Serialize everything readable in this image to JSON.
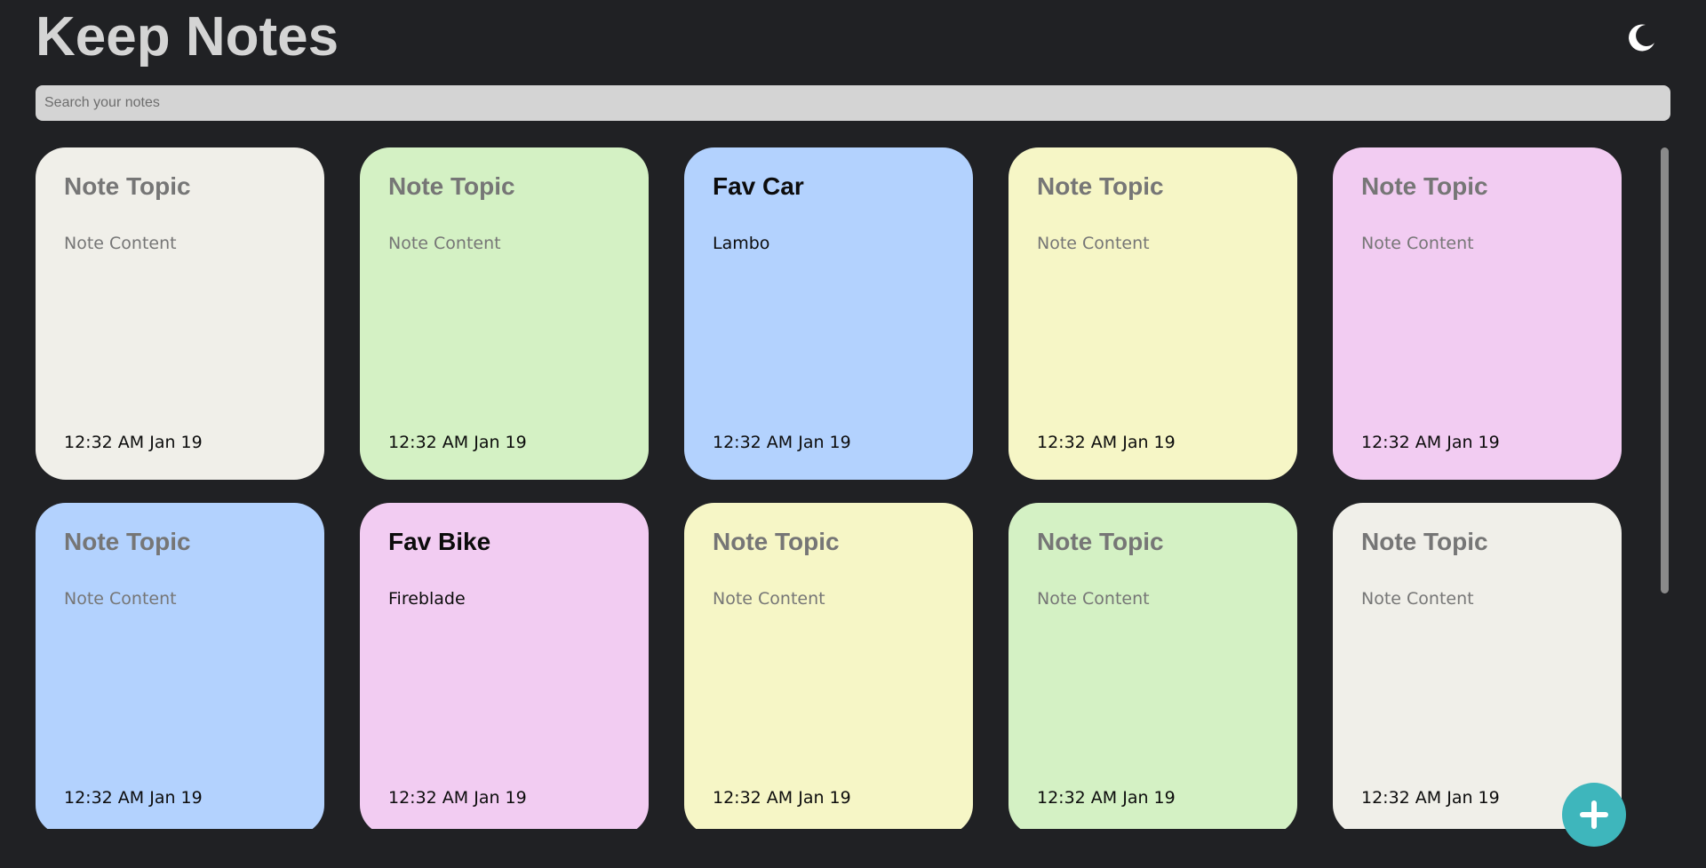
{
  "app": {
    "title": "Keep Notes",
    "theme_toggle_icon": "moon-icon",
    "add_button_icon": "plus-icon"
  },
  "search": {
    "placeholder": "Search your notes",
    "value": ""
  },
  "notes": [
    {
      "title": "Note Topic",
      "content": "Note Content",
      "time": "12:32 AM Jan 19",
      "color": "#f0efe9",
      "filled": false
    },
    {
      "title": "Note Topic",
      "content": "Note Content",
      "time": "12:32 AM Jan 19",
      "color": "#d4f1c4",
      "filled": false
    },
    {
      "title": "Fav Car",
      "content": "Lambo",
      "time": "12:32 AM Jan 19",
      "color": "#b3d2fe",
      "filled": true
    },
    {
      "title": "Note Topic",
      "content": "Note Content",
      "time": "12:32 AM Jan 19",
      "color": "#f6f6c6",
      "filled": false
    },
    {
      "title": "Note Topic",
      "content": "Note Content",
      "time": "12:32 AM Jan 19",
      "color": "#f2ccf2",
      "filled": false
    },
    {
      "title": "Note Topic",
      "content": "Note Content",
      "time": "12:32 AM Jan 19",
      "color": "#b3d2fe",
      "filled": false
    },
    {
      "title": "Fav Bike",
      "content": "Fireblade",
      "time": "12:32 AM Jan 19",
      "color": "#f2ccf2",
      "filled": true
    },
    {
      "title": "Note Topic",
      "content": "Note Content",
      "time": "12:32 AM Jan 19",
      "color": "#f6f6c6",
      "filled": false
    },
    {
      "title": "Note Topic",
      "content": "Note Content",
      "time": "12:32 AM Jan 19",
      "color": "#d4f1c4",
      "filled": false
    },
    {
      "title": "Note Topic",
      "content": "Note Content",
      "time": "12:32 AM Jan 19",
      "color": "#f0efe9",
      "filled": false
    }
  ],
  "colors": {
    "background": "#202124",
    "title": "#d4d4d4",
    "search_bg": "#d4d4d4",
    "fab": "#3eb6bc",
    "scrollbar": "#8a8a8a",
    "placeholder_text": "#767676",
    "filled_text": "#0c0c0c"
  }
}
